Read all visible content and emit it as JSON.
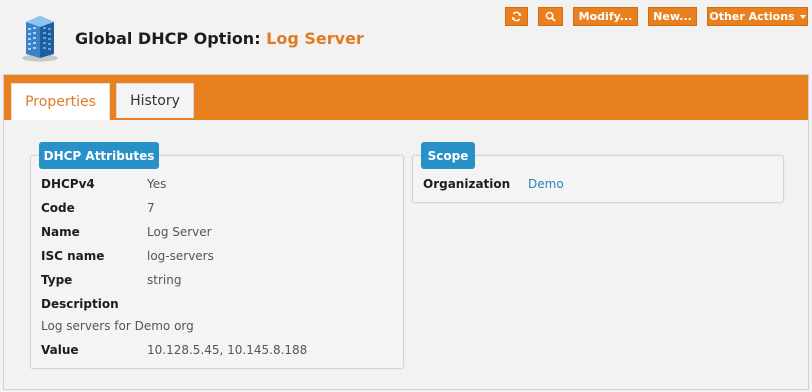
{
  "header": {
    "title_prefix": "Global DHCP Option: ",
    "title_name": "Log Server",
    "icon": "building-icon"
  },
  "toolbar": {
    "refresh_icon": "refresh-icon",
    "search_icon": "search-icon",
    "modify_label": "Modify...",
    "new_label": "New...",
    "other_actions_label": "Other Actions"
  },
  "tabs": {
    "properties": "Properties",
    "history": "History"
  },
  "dhcp_attributes": {
    "heading": "DHCP Attributes",
    "dhcpv4_key": "DHCPv4",
    "dhcpv4_value": "Yes",
    "code_key": "Code",
    "code_value": "7",
    "name_key": "Name",
    "name_value": "Log Server",
    "isc_key": "ISC name",
    "isc_value": "log-servers",
    "type_key": "Type",
    "type_value": "string",
    "description_key": "Description",
    "description_value": "Log servers for Demo org",
    "value_key": "Value",
    "value_value": "10.128.5.45, 10.145.8.188"
  },
  "scope": {
    "heading": "Scope",
    "organization_key": "Organization",
    "organization_value": "Demo"
  },
  "colors": {
    "accent_orange": "#e8801f",
    "label_blue": "#2891c7",
    "link_blue": "#2a86b8"
  }
}
